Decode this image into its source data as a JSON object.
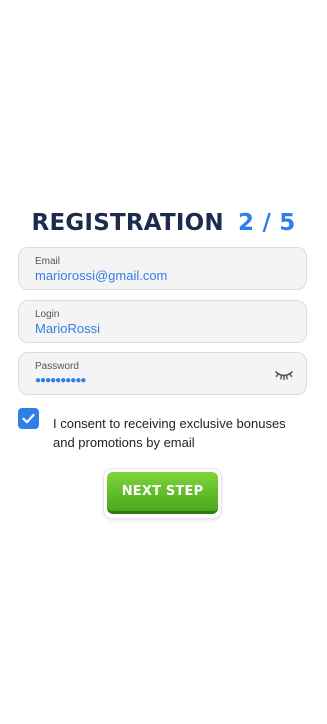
{
  "title": {
    "main": "REGISTRATION",
    "step": "2 / 5"
  },
  "fields": {
    "email": {
      "label": "Email",
      "value": "mariorossi@gmail.com"
    },
    "login": {
      "label": "Login",
      "value": "MarioRossi"
    },
    "password": {
      "label": "Password",
      "value": "●●●●●●●●●●",
      "icon": "eye-closed-icon"
    }
  },
  "consent": {
    "checked": true,
    "text": "I consent to receiving exclusive bonuses and promotions by email"
  },
  "button": {
    "label": "NEXT STEP"
  },
  "colors": {
    "accent": "#2f7fe6",
    "title": "#1d2b4f",
    "button": "#5cb82a"
  }
}
